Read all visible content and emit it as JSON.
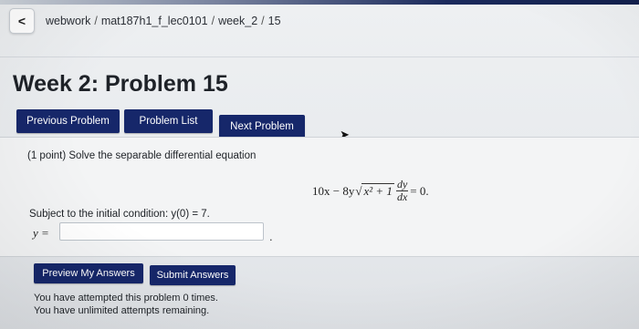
{
  "header": {
    "back_symbol": "<",
    "breadcrumb": [
      "webwork",
      "mat187h1_f_lec0101",
      "week_2",
      "15"
    ],
    "separator": "/"
  },
  "page_title": "Week 2: Problem 15",
  "nav": {
    "previous_label": "Previous Problem",
    "list_label": "Problem List",
    "next_label": "Next Problem"
  },
  "problem": {
    "points_text": "(1 point) Solve the separable differential equation",
    "equation": {
      "lhs_a": "10x − 8y",
      "radicand": "x² + 1",
      "deriv_num": "dy",
      "deriv_den": "dx",
      "rhs": "= 0."
    },
    "condition_text": "Subject to the initial condition: y(0) = 7.",
    "answer_label": "y =",
    "answer_value": "",
    "trailing": "."
  },
  "actions": {
    "preview_label": "Preview My Answers",
    "submit_label": "Submit Answers"
  },
  "attempts": {
    "line1": "You have attempted this problem 0 times.",
    "line2": "You have unlimited attempts remaining."
  },
  "colors": {
    "button_bg": "#16276a",
    "button_text": "#ffffff",
    "background": "#e9ecef"
  },
  "icons": {
    "back": "chevron-left-icon",
    "cursor": "mouse-cursor-icon"
  }
}
